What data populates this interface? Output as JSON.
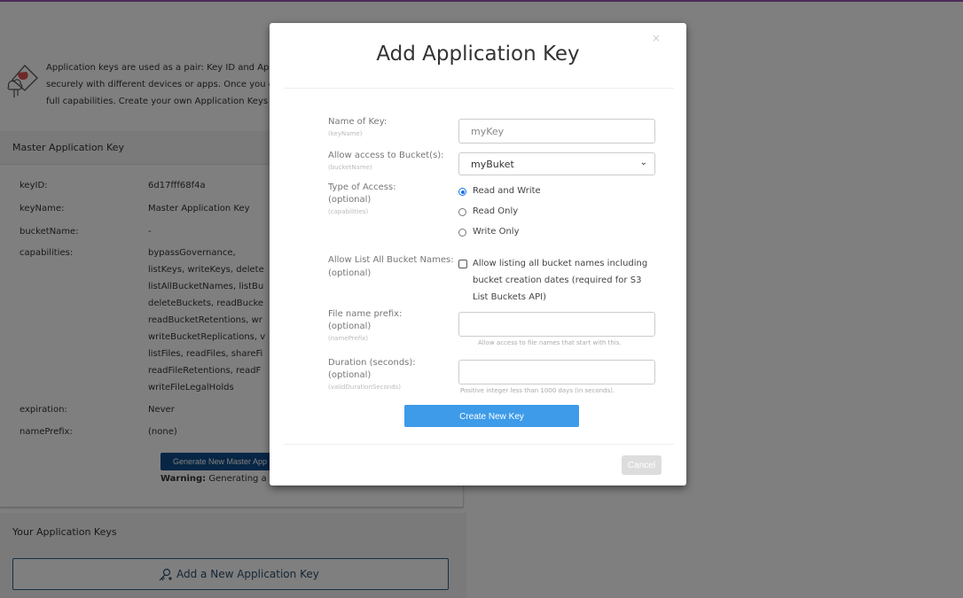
{
  "intro": {
    "line1": "Application keys are used as a pair: Key ID and Applic",
    "line2": "securely with different devices or apps. Once you ger",
    "line3": "full capabilities. Create your own Application Keys to"
  },
  "master": {
    "title": "Master Application Key",
    "rows": [
      {
        "key": "keyID:",
        "value": "6d17fff68f4a"
      },
      {
        "key": "keyName:",
        "value": "Master Application Key"
      },
      {
        "key": "bucketName:",
        "value": "-"
      },
      {
        "key": "capabilities:",
        "lines": [
          "bypassGovernance,",
          "listKeys, writeKeys, delete",
          "listAllBucketNames, listBu",
          "deleteBuckets, readBucke",
          "readBucketRetentions, wr",
          "writeBucketReplications, v",
          "listFiles, readFiles, shareFi",
          "readFileRetentions, readF",
          "writeFileLegalHolds"
        ]
      },
      {
        "key": "expiration:",
        "value": "Never"
      },
      {
        "key": "namePrefix:",
        "value": "(none)"
      }
    ],
    "generate_label": "Generate New Master App",
    "warning_bold": "Warning:",
    "warning_text": " Generating a ne"
  },
  "your_keys": {
    "title": "Your Application Keys",
    "add_label": "Add a New Application Key"
  },
  "modal": {
    "title": "Add Application Key",
    "close": "×",
    "fields": {
      "name": {
        "label": "Name of Key:",
        "sub": "(keyName)",
        "value": "myKey"
      },
      "bucket": {
        "label": "Allow access to Bucket(s):",
        "sub": "(bucketName)",
        "value": "myBuket"
      },
      "access": {
        "label": "Type of Access:",
        "optional": "(optional)",
        "sub": "(capabilities)",
        "options": [
          "Read and Write",
          "Read Only",
          "Write Only"
        ],
        "selected": "Read and Write"
      },
      "list_all": {
        "label": "Allow List All Bucket Names:",
        "optional": "(optional)",
        "text": "Allow listing all bucket names including bucket creation dates (required for S3 List Buckets API)",
        "checked": false
      },
      "prefix": {
        "label": "File name prefix:",
        "optional": "(optional)",
        "sub": "(namePrefix)",
        "value": "",
        "hint": "Allow access to file names that start with this."
      },
      "duration": {
        "label": "Duration (seconds):",
        "optional": "(optional)",
        "sub": "(validDurationSeconds)",
        "value": "",
        "hint": "Positive integer less than 1000 days (in seconds)."
      }
    },
    "create_label": "Create New Key",
    "cancel_label": "Cancel"
  },
  "colors": {
    "accent": "#3d9be9",
    "dark_button": "#0f4c8a",
    "overlay": "rgba(0,0,0,0.5)"
  }
}
